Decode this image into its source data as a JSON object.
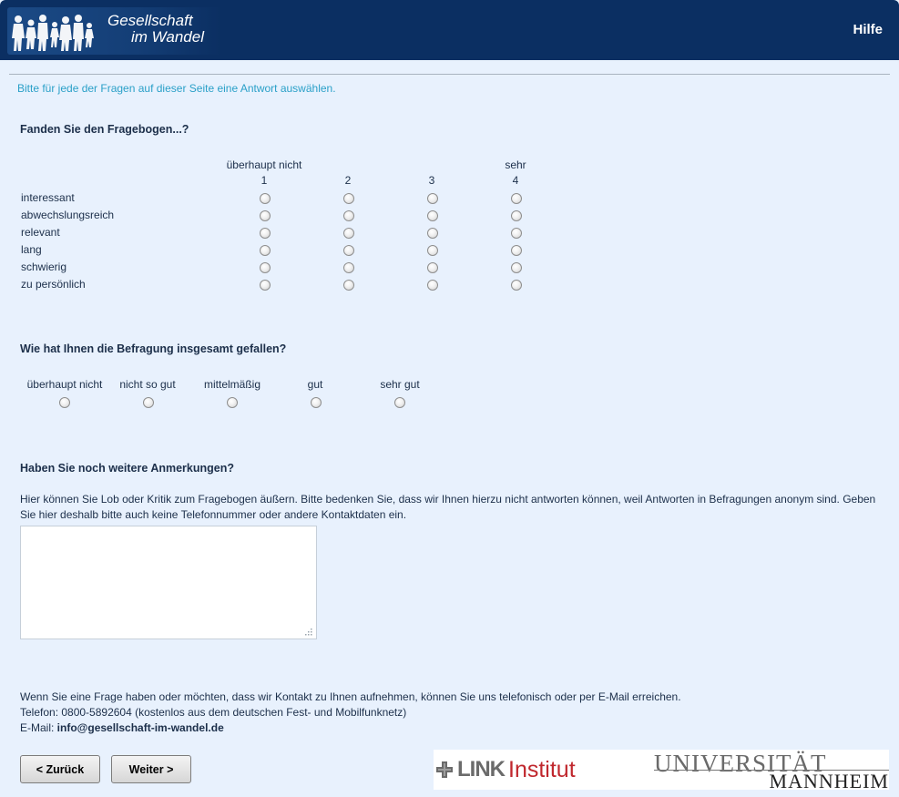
{
  "header": {
    "logo_line1": "Gesellschaft",
    "logo_line2": "im Wandel",
    "help_label": "Hilfe"
  },
  "instruction": "Bitte für jede der Fragen auf dieser Seite eine Antwort auswählen.",
  "q1": {
    "title": "Fanden Sie den Fragebogen...?",
    "scale_low": "überhaupt nicht",
    "scale_high": "sehr",
    "scale_numbers": [
      "1",
      "2",
      "3",
      "4"
    ],
    "rows": [
      "interessant",
      "abwechslungsreich",
      "relevant",
      "lang",
      "schwierig",
      "zu persönlich"
    ]
  },
  "q2": {
    "title": "Wie hat Ihnen die Befragung insgesamt gefallen?",
    "options": [
      "überhaupt nicht",
      "nicht so gut",
      "mittelmäßig",
      "gut",
      "sehr gut"
    ]
  },
  "q3": {
    "title": "Haben Sie noch weitere Anmerkungen?",
    "text": "Hier können Sie Lob oder Kritik zum Fragebogen äußern. Bitte bedenken Sie, dass wir Ihnen hierzu nicht antworten können, weil Antworten in Befragungen anonym sind. Geben Sie hier deshalb bitte auch keine Telefonnummer oder andere Kontaktdaten ein.",
    "comment_value": ""
  },
  "contact": {
    "line1": "Wenn Sie eine Frage haben oder möchten, dass wir Kontakt zu Ihnen aufnehmen, können Sie uns telefonisch oder per E-Mail erreichen.",
    "phone_line": "Telefon: 0800-5892604 (kostenlos aus dem deutschen Fest- und Mobilfunknetz)",
    "email_label": "E-Mail: ",
    "email": "info@gesellschaft-im-wandel.de"
  },
  "nav": {
    "back_label": "< Zurück",
    "next_label": "Weiter >"
  },
  "logos": {
    "link_word": "LINK",
    "institut_word": "Institut",
    "uni_line1": "UNIVERSITÄT",
    "uni_line2": "MANNHEIM"
  },
  "colors": {
    "header_bg": "#0b2f62",
    "page_bg": "#e8f1fd",
    "instruction": "#2aa0c8",
    "text": "#1c2f4a",
    "link_red": "#c0272d"
  }
}
